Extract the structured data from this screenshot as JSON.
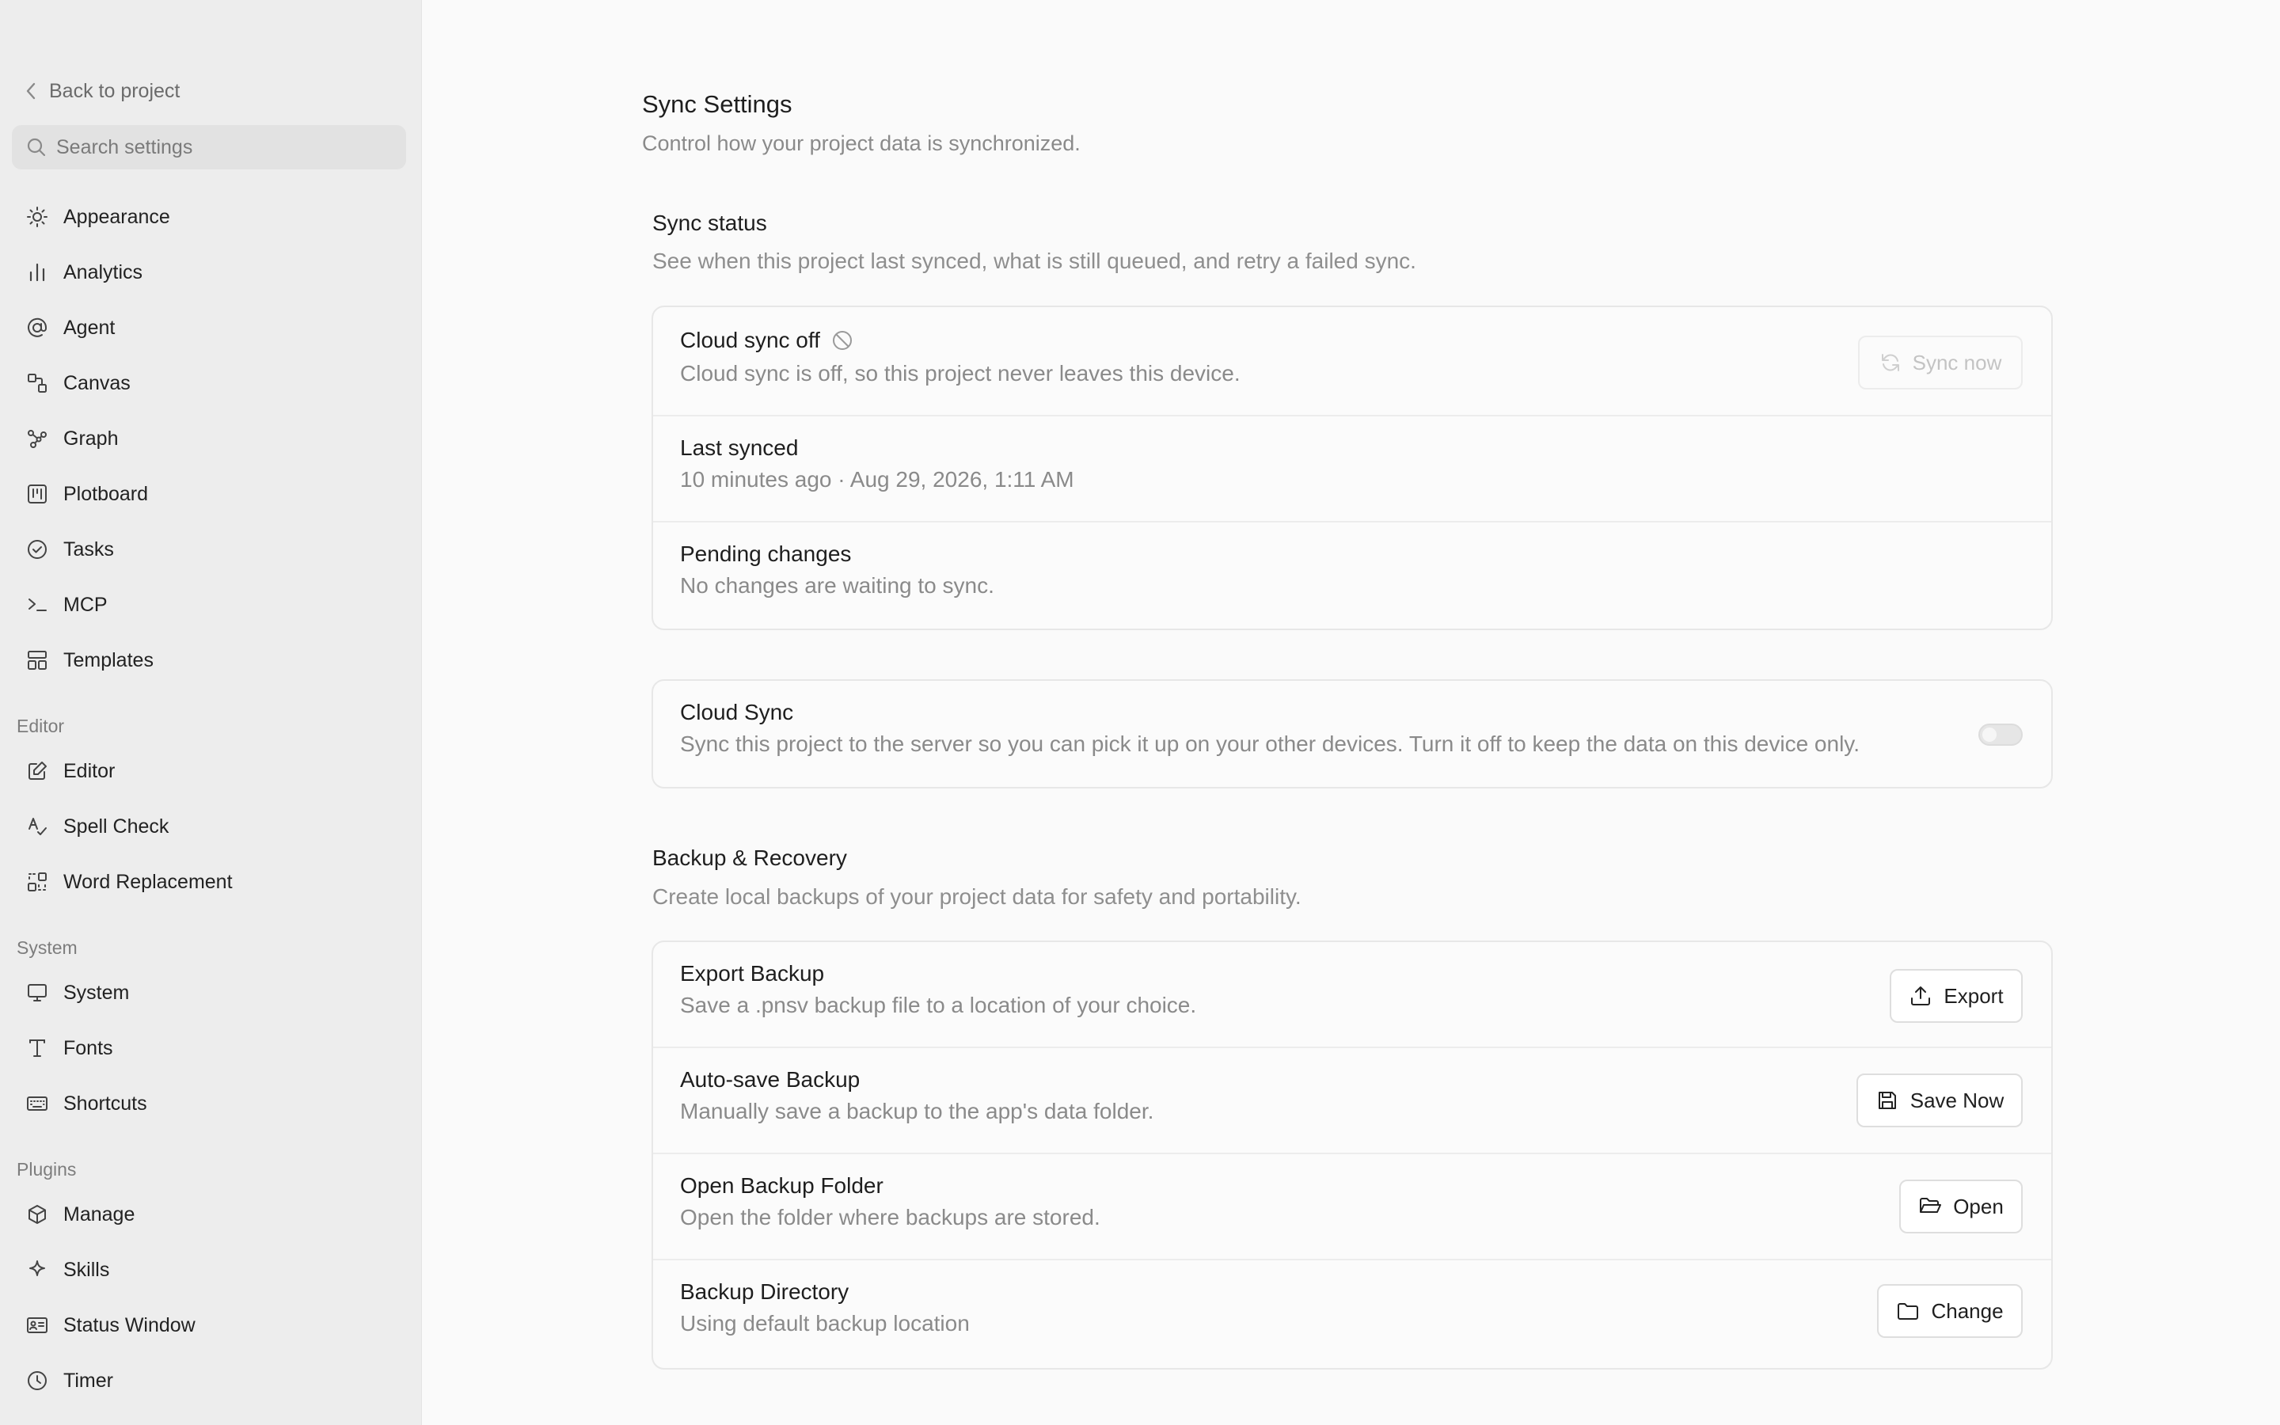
{
  "sidebar": {
    "back_label": "Back to project",
    "search_placeholder": "Search settings",
    "items": [
      {
        "label": "Appearance",
        "icon": "sun-icon"
      },
      {
        "label": "Analytics",
        "icon": "bar-chart-icon"
      },
      {
        "label": "Agent",
        "icon": "at-sign-icon"
      },
      {
        "label": "Canvas",
        "icon": "shapes-icon"
      },
      {
        "label": "Graph",
        "icon": "graph-nodes-icon"
      },
      {
        "label": "Plotboard",
        "icon": "kanban-icon"
      },
      {
        "label": "Tasks",
        "icon": "check-circle-icon"
      },
      {
        "label": "MCP",
        "icon": "terminal-icon"
      },
      {
        "label": "Templates",
        "icon": "layout-template-icon"
      }
    ],
    "sections": [
      {
        "label": "Editor",
        "items": [
          {
            "label": "Editor",
            "icon": "edit-icon"
          },
          {
            "label": "Spell Check",
            "icon": "spell-check-icon"
          },
          {
            "label": "Word Replacement",
            "icon": "replace-icon"
          }
        ]
      },
      {
        "label": "System",
        "items": [
          {
            "label": "System",
            "icon": "monitor-icon"
          },
          {
            "label": "Fonts",
            "icon": "type-icon"
          },
          {
            "label": "Shortcuts",
            "icon": "keyboard-icon"
          }
        ]
      },
      {
        "label": "Plugins",
        "items": [
          {
            "label": "Manage",
            "icon": "package-icon"
          },
          {
            "label": "Skills",
            "icon": "sparkle-icon"
          },
          {
            "label": "Status Window",
            "icon": "id-card-icon"
          },
          {
            "label": "Timer",
            "icon": "clock-icon"
          }
        ]
      }
    ]
  },
  "main": {
    "title": "Sync Settings",
    "subtitle": "Control how your project data is synchronized.",
    "sync_status": {
      "title": "Sync status",
      "subtitle": "See when this project last synced, what is still queued, and retry a failed sync.",
      "rows": [
        {
          "title": "Cloud sync off",
          "desc": "Cloud sync is off, so this project never leaves this device.",
          "button": "Sync now"
        },
        {
          "title": "Last synced",
          "desc": "10 minutes ago · Aug 29, 2026, 1:11 AM"
        },
        {
          "title": "Pending changes",
          "desc": "No changes are waiting to sync."
        }
      ]
    },
    "cloud_sync": {
      "title": "Cloud Sync",
      "desc": "Sync this project to the server so you can pick it up on your other devices. Turn it off to keep the data on this device only.",
      "enabled": false
    },
    "backup": {
      "title": "Backup & Recovery",
      "subtitle": "Create local backups of your project data for safety and portability.",
      "rows": [
        {
          "title": "Export Backup",
          "desc": "Save a .pnsv backup file to a location of your choice.",
          "button": "Export",
          "icon": "upload-icon"
        },
        {
          "title": "Auto-save Backup",
          "desc": "Manually save a backup to the app's data folder.",
          "button": "Save Now",
          "icon": "save-icon"
        },
        {
          "title": "Open Backup Folder",
          "desc": "Open the folder where backups are stored.",
          "button": "Open",
          "icon": "folder-open-icon"
        },
        {
          "title": "Backup Directory",
          "desc": "Using default backup location",
          "button": "Change",
          "icon": "folder-icon"
        }
      ]
    }
  }
}
